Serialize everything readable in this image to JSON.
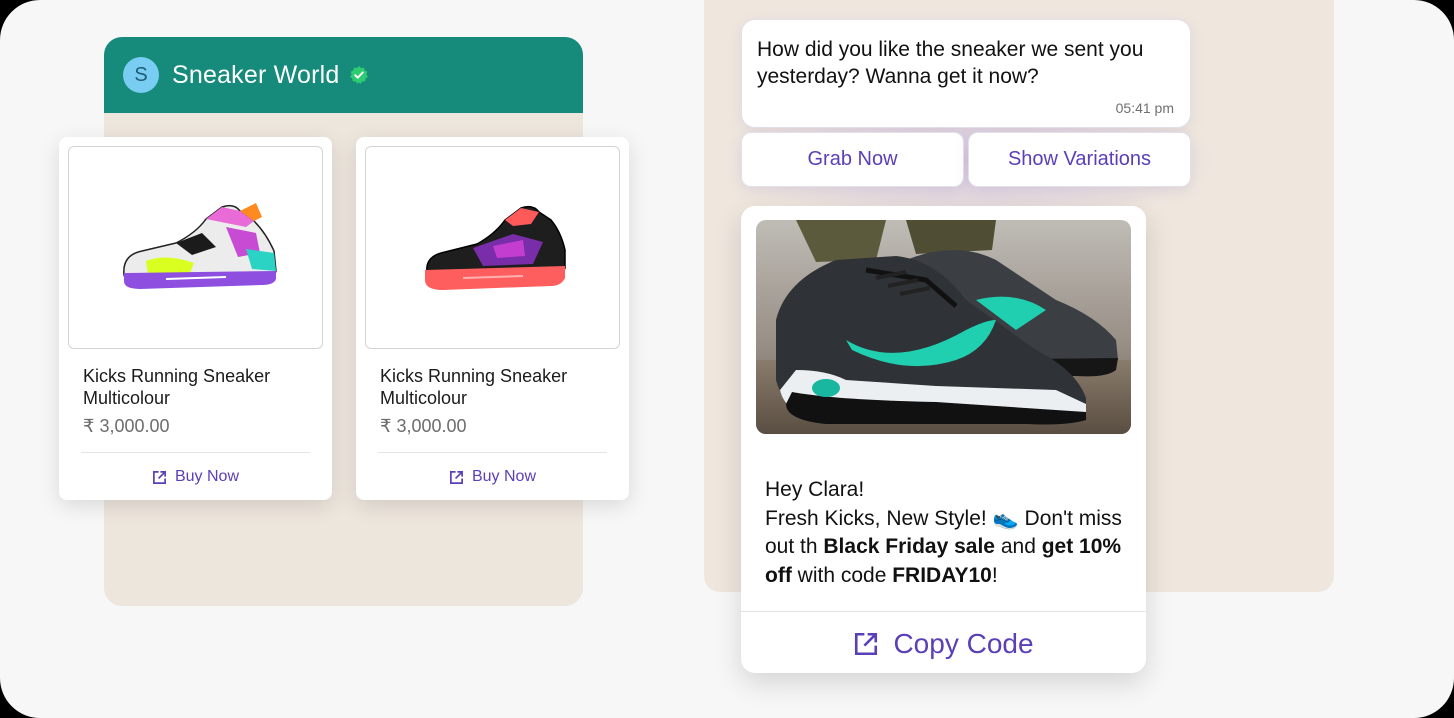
{
  "colors": {
    "header_green": "#168a7b",
    "chat_bg": "#ede6dd",
    "accent_purple": "#5a3fb8",
    "verified_green": "#2ecc71"
  },
  "left_chat": {
    "avatar_letter": "S",
    "business_name": "Sneaker World",
    "verified_icon": "verified-badge-icon",
    "products": [
      {
        "name": "Kicks Running Sneaker Multicolour",
        "price": "₹ 3,000.00",
        "action": "Buy Now",
        "action_icon": "external-link-icon"
      },
      {
        "name": "Kicks Running Sneaker Multicolour",
        "price": "₹ 3,000.00",
        "action": "Buy Now",
        "action_icon": "external-link-icon"
      }
    ]
  },
  "right_chat": {
    "message": {
      "text": "How did you like the sneaker we sent you yesterday? Wanna get it now?",
      "time": "05:41 pm"
    },
    "quick_replies": [
      "Grab Now",
      "Show Variations"
    ],
    "promo": {
      "greeting": "Hey Clara!",
      "line_start": "Fresh Kicks, New Style! ",
      "emoji": "👟",
      "dont_miss": " Don't miss out th ",
      "sale": "Black Friday sale",
      "and": " and ",
      "offer": "get 10% off",
      "with_code": " with code ",
      "code": "FRIDAY10",
      "end": "!",
      "action": "Copy Code",
      "action_icon": "external-link-icon"
    }
  }
}
